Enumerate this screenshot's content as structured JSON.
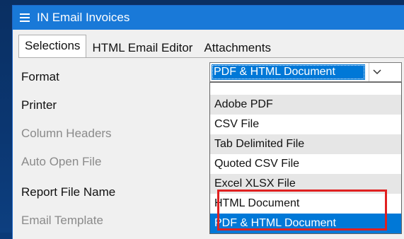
{
  "window": {
    "title": "IN Email Invoices"
  },
  "tabs": [
    {
      "label": "Selections"
    },
    {
      "label": "HTML Email Editor"
    },
    {
      "label": "Attachments"
    }
  ],
  "fields": {
    "format": "Format",
    "printer": "Printer",
    "column_headers": "Column Headers",
    "auto_open_file": "Auto Open File",
    "report_file_name": "Report File Name",
    "email_template": "Email Template"
  },
  "format_combo": {
    "selected_value": "PDF & HTML Document",
    "options": [
      "Adobe PDF",
      "CSV File",
      "Tab Delimited File",
      "Quoted CSV File",
      "Excel XLSX File",
      "HTML Document",
      "PDF & HTML Document"
    ]
  },
  "colors": {
    "titlebar": "#1979d8",
    "selection": "#0078d7",
    "annotation_box": "#e02020",
    "disabled_text": "#8a8a8a"
  },
  "icons": {
    "menu": "hamburger-menu-icon",
    "dropdown": "chevron-down-icon"
  }
}
